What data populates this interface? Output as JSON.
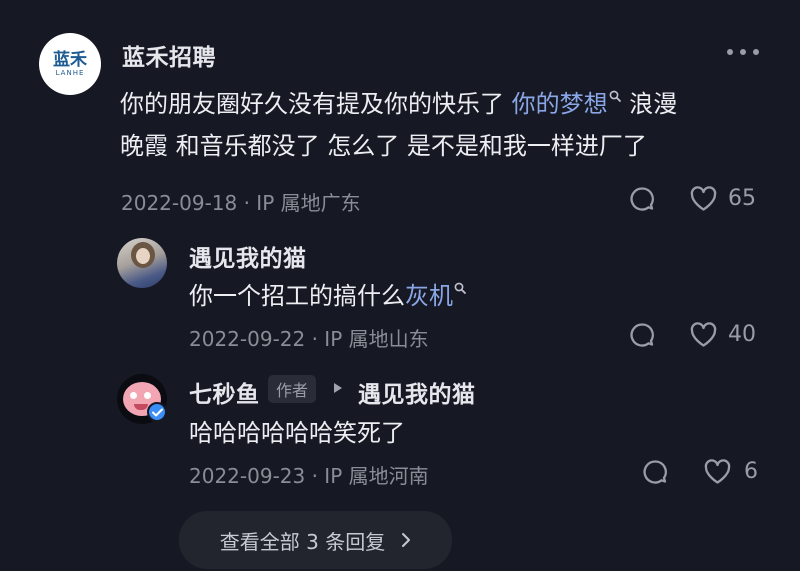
{
  "main_comment": {
    "username": "蓝禾招聘",
    "avatar_text": "蓝禾",
    "avatar_subtext": "LANHE",
    "text_before": "你的朋友圈好久没有提及你的快乐了 ",
    "link": "你的梦想",
    "text_after_line1": " 浪漫",
    "text_line2": "晚霞 和音乐都没了 怎么了 是不是和我一样进厂了",
    "meta": "2022-09-18 · IP 属地广东",
    "likes": "65"
  },
  "replies": [
    {
      "username": "遇见我的猫",
      "text_before": "你一个招工的搞什么",
      "link": "灰机",
      "meta": "2022-09-22 · IP 属地山东",
      "likes": "40"
    },
    {
      "username": "七秒鱼",
      "author_tag": "作者",
      "reply_to": "遇见我的猫",
      "text": "哈哈哈哈哈哈笑死了",
      "meta": "2022-09-23 · IP 属地河南",
      "likes": "6"
    }
  ],
  "view_all_replies": "查看全部 3 条回复",
  "colors": {
    "background": "#161823",
    "link": "#8aa6e6",
    "meta": "#8a8c96",
    "lanhe_brand": "#1e5b93"
  }
}
